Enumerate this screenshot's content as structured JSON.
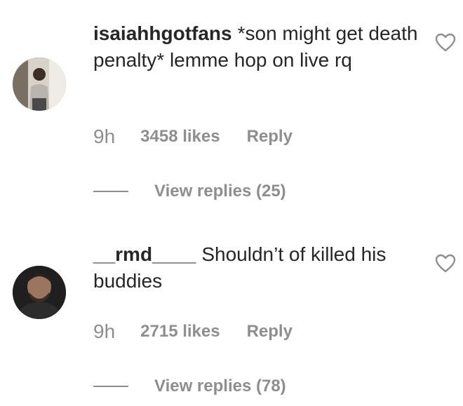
{
  "comments": [
    {
      "username": "isaiahhgotfans",
      "text": "*son might get death penalty* lemme hop on live rq",
      "time": "9h",
      "likes": "3458 likes",
      "reply_label": "Reply",
      "view_replies": "View replies (25)",
      "avatar": "profile-photo"
    },
    {
      "username": "__rmd____",
      "text": "Shouldn’t of killed his buddies",
      "time": "9h",
      "likes": "2715 likes",
      "reply_label": "Reply",
      "view_replies": "View replies (78)",
      "avatar": "profile-photo"
    }
  ],
  "icons": {
    "like": "heart-outline-icon"
  },
  "colors": {
    "text": "#262626",
    "secondary": "#8e8e8e",
    "background": "#ffffff"
  }
}
